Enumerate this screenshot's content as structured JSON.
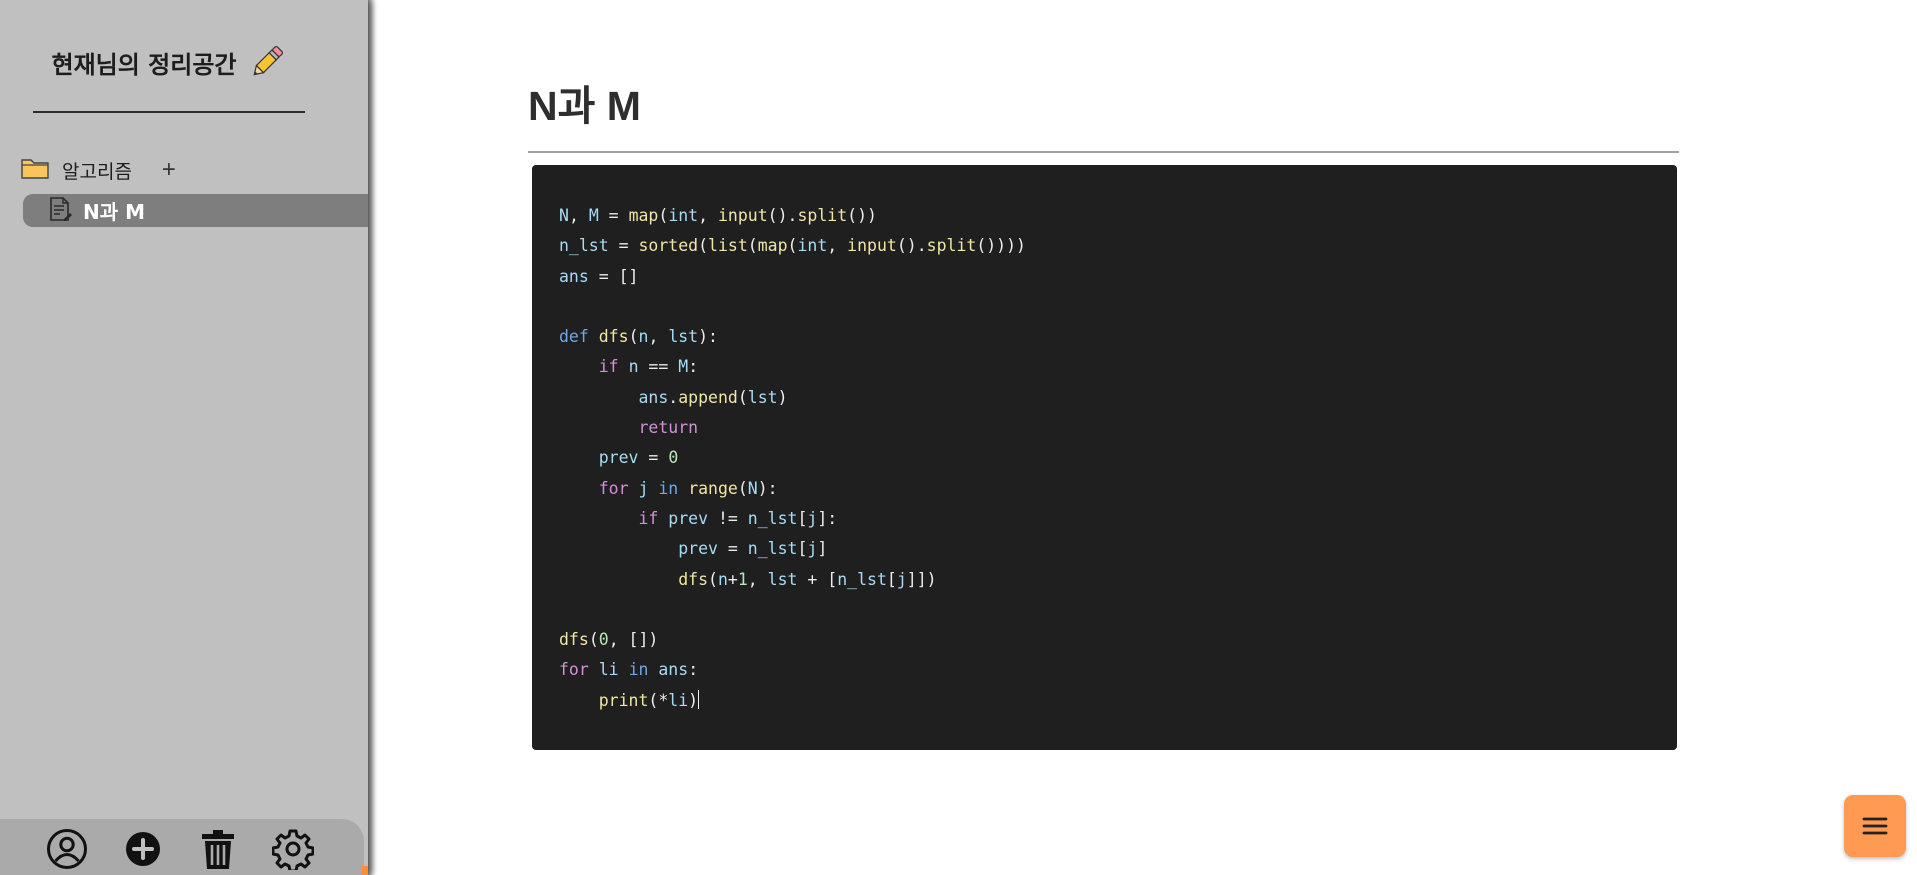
{
  "sidebar": {
    "brand_title": "현재님의 정리공간",
    "brand_icon": "pencil-icon",
    "folder": {
      "label": "알고리즘",
      "icon": "folder-icon",
      "add_label": "+"
    },
    "pages": [
      {
        "label": "N과 M",
        "icon": "document-icon",
        "selected": true
      }
    ],
    "toolbar": [
      {
        "icon": "user-circle-icon"
      },
      {
        "icon": "plus-circle-icon"
      },
      {
        "icon": "trash-icon"
      },
      {
        "icon": "gear-icon"
      }
    ]
  },
  "main": {
    "title": "N과 M",
    "code_language": "python",
    "code_lines": [
      "N, M = map(int, input().split())",
      "n_lst = sorted(list(map(int, input().split())))",
      "ans = []",
      "",
      "def dfs(n, lst):",
      "    if n == M:",
      "        ans.append(lst)",
      "        return",
      "    prev = 0",
      "    for j in range(N):",
      "        if prev != n_lst[j]:",
      "            prev = n_lst[j]",
      "            dfs(n+1, lst + [n_lst[j]])",
      "",
      "dfs(0, [])",
      "for li in ans:",
      "    print(*li)"
    ]
  },
  "fab": {
    "icon": "hamburger-menu-icon"
  },
  "colors": {
    "sidebar_bg": "#c0c0c0",
    "selected_item_bg": "#7e7e7e",
    "toolbar_bg": "#aaaaaa",
    "code_bg": "#1f1f1f",
    "accent_orange": "#ff9a52"
  }
}
